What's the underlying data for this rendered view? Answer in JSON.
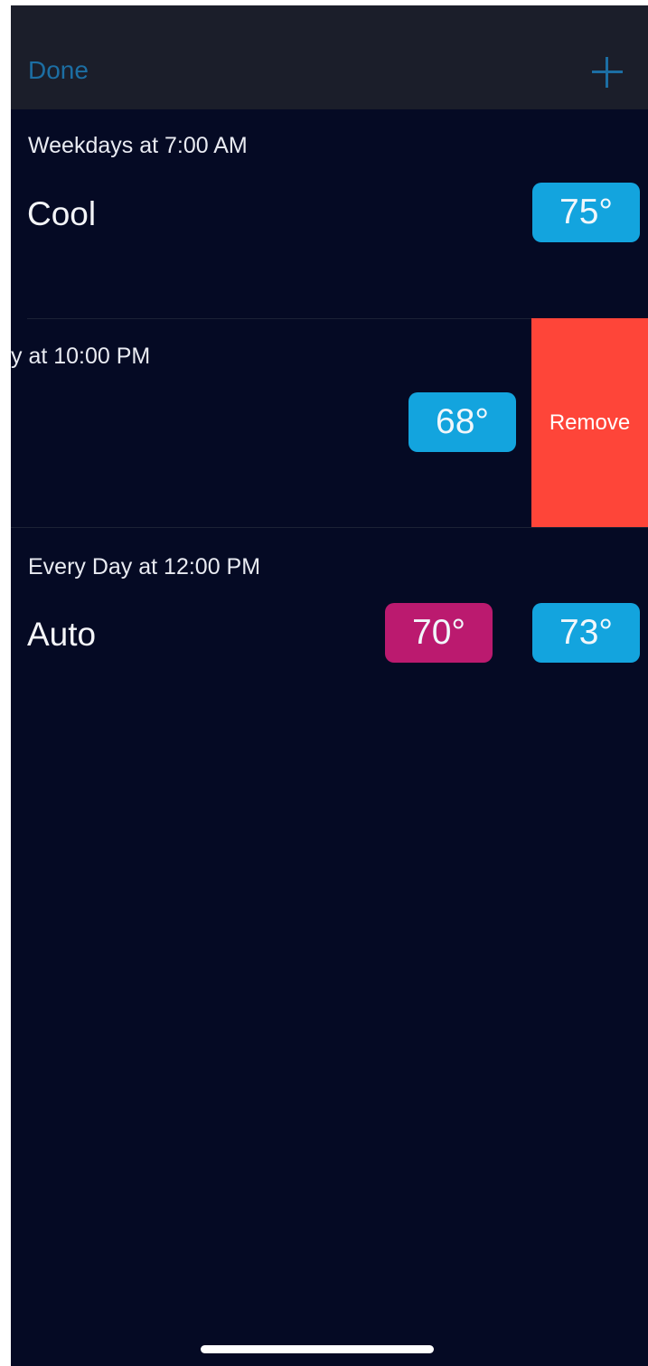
{
  "navbar": {
    "done_label": "Done",
    "add_icon": "plus-icon"
  },
  "schedules": [
    {
      "label": "Weekdays at 7:00 AM",
      "mode": "Cool",
      "cool_temp": "75°"
    },
    {
      "label_visible": "y at 10:00 PM",
      "cool_temp": "68°",
      "remove_label": "Remove"
    },
    {
      "label": "Every Day at 12:00 PM",
      "mode": "Auto",
      "heat_temp": "70°",
      "cool_temp": "73°"
    }
  ],
  "colors": {
    "background": "#050a24",
    "navbar": "#1b1e2a",
    "accent_blue": "#1c6ea3",
    "cool_pill": "#13a4de",
    "heat_pill": "#bb1a6f",
    "remove": "#fe4539"
  }
}
